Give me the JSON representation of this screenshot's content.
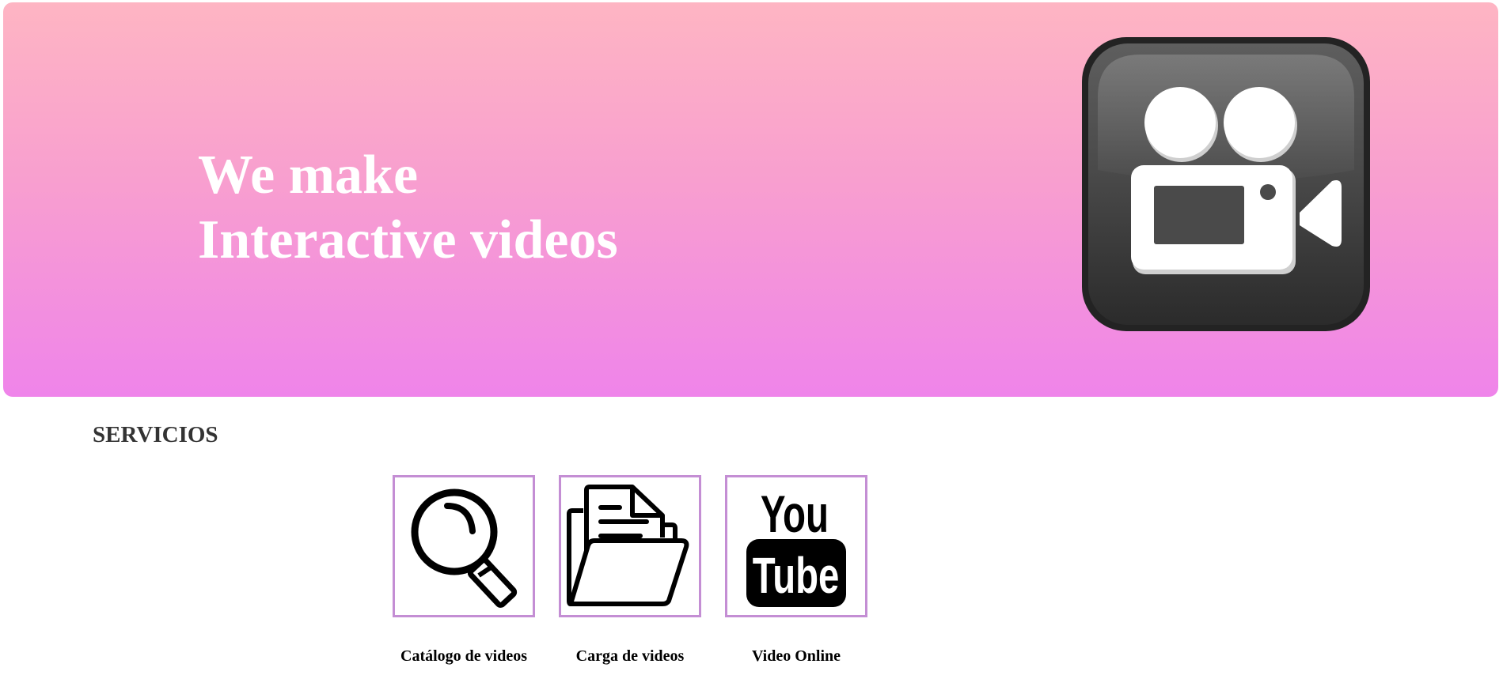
{
  "hero": {
    "title_line1": "We make",
    "title_line2": "Interactive videos",
    "icon": "video-camera-icon",
    "gradient": [
      "#feb5c3",
      "#ef84ea"
    ]
  },
  "services": {
    "title": "SERVICIOS",
    "items": [
      {
        "label": "Catálogo de videos",
        "icon": "magnifier-icon"
      },
      {
        "label": "Carga de videos",
        "icon": "folder-documents-icon"
      },
      {
        "label": "Video Online",
        "icon": "youtube-icon"
      }
    ],
    "border_color": "#c48ed4"
  }
}
